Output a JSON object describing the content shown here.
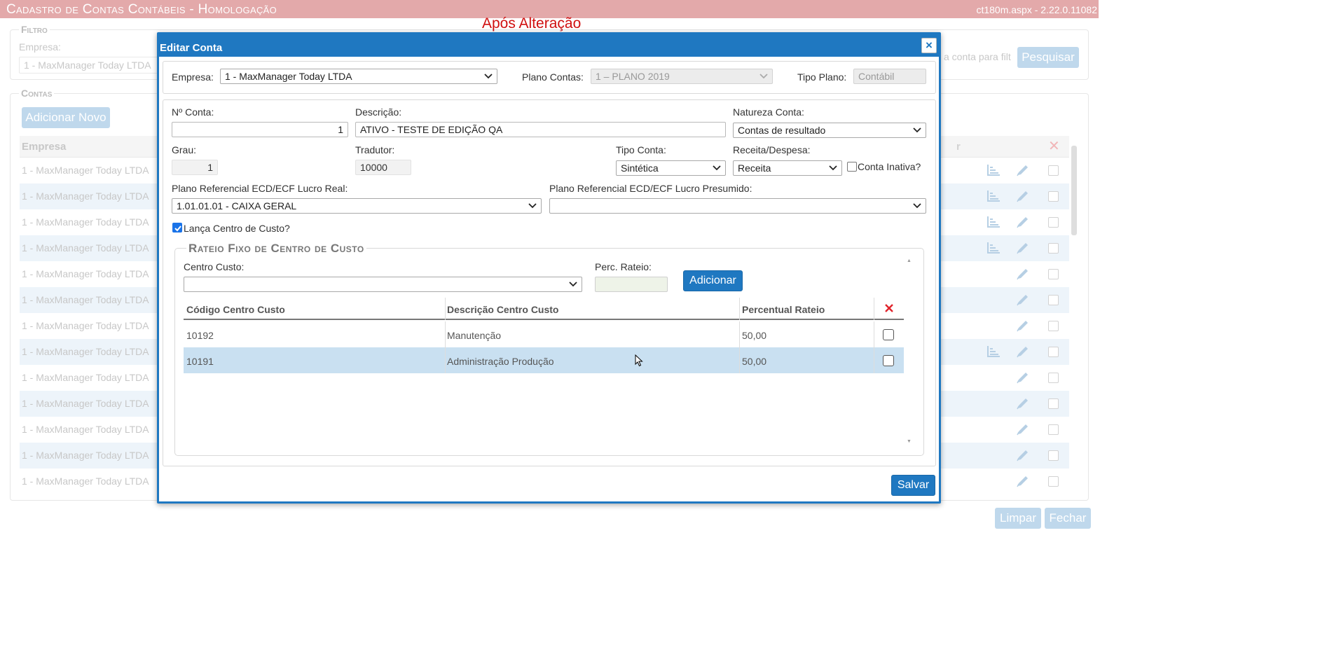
{
  "page": {
    "title": "Cadastro de Contas Contábeis  - Homologação",
    "version": "ct180m.aspx - 2.22.0.11082",
    "annotation": "Após Alteração"
  },
  "filter": {
    "legend": "Filtro",
    "empresa_label": "Empresa:",
    "empresa_value": "1 - MaxManager Today LTDA",
    "search_placeholder": "a conta para filt",
    "search_button": "Pesquisar"
  },
  "contas": {
    "legend": "Contas",
    "add_button": "Adicionar Novo",
    "col_empresa": "Empresa",
    "col_partial": "r",
    "rows": [
      {
        "empresa": "1 - MaxManager Today LTDA",
        "chart": true
      },
      {
        "empresa": "1 - MaxManager Today LTDA",
        "chart": true
      },
      {
        "empresa": "1 - MaxManager Today LTDA",
        "chart": true
      },
      {
        "empresa": "1 - MaxManager Today LTDA",
        "chart": true
      },
      {
        "empresa": "1 - MaxManager Today LTDA",
        "chart": false
      },
      {
        "empresa": "1 - MaxManager Today LTDA",
        "chart": false
      },
      {
        "empresa": "1 - MaxManager Today LTDA",
        "chart": false
      },
      {
        "empresa": "1 - MaxManager Today LTDA",
        "chart": true
      },
      {
        "empresa": "1 - MaxManager Today LTDA",
        "chart": false
      },
      {
        "empresa": "1 - MaxManager Today LTDA",
        "chart": false
      },
      {
        "empresa": "1 - MaxManager Today LTDA",
        "chart": false
      },
      {
        "empresa": "1 - MaxManager Today LTDA",
        "chart": false
      },
      {
        "empresa": "1 - MaxManager Today LTDA",
        "chart": false
      }
    ]
  },
  "footer": {
    "limpar": "Limpar",
    "fechar": "Fechar"
  },
  "modal": {
    "title": "Editar Conta",
    "close": "×",
    "empresa_label": "Empresa:",
    "empresa_value": "1 - MaxManager Today LTDA",
    "plano_contas_label": "Plano Contas:",
    "plano_contas_value": "1 – PLANO 2019",
    "tipo_plano_label": "Tipo Plano:",
    "tipo_plano_value": "Contábil",
    "num_conta_label": "Nº Conta:",
    "num_conta_value": "1",
    "descricao_label": "Descrição:",
    "descricao_value": "ATIVO - TESTE DE EDIÇÃO QA",
    "natureza_label": "Natureza Conta:",
    "natureza_value": "Contas de resultado",
    "grau_label": "Grau:",
    "grau_value": "1",
    "tradutor_label": "Tradutor:",
    "tradutor_value": "10000",
    "tipo_conta_label": "Tipo Conta:",
    "tipo_conta_value": "Sintética",
    "receita_label": "Receita/Despesa:",
    "receita_value": "Receita",
    "conta_inativa_label": "Conta Inativa?",
    "conta_inativa_checked": false,
    "plano_real_label": "Plano Referencial ECD/ECF Lucro Real:",
    "plano_real_value": "1.01.01.01 - CAIXA GERAL",
    "plano_presumido_label": "Plano Referencial ECD/ECF Lucro Presumido:",
    "plano_presumido_value": "",
    "lanca_cc_label": "Lança Centro de Custo?",
    "lanca_cc_checked": true,
    "rateio": {
      "legend": "Rateio Fixo de Centro de Custo",
      "centro_custo_label": "Centro Custo:",
      "centro_custo_value": "",
      "perc_label": "Perc. Rateio:",
      "perc_value": "",
      "add_button": "Adicionar",
      "columns": [
        "Código Centro Custo",
        "Descrição Centro Custo",
        "Percentual Rateio"
      ],
      "rows": [
        {
          "codigo": "10192",
          "descricao": "Manutenção",
          "percentual": "50,00",
          "selected": false
        },
        {
          "codigo": "10191",
          "descricao": "Administração Produção",
          "percentual": "50,00",
          "selected": true
        }
      ]
    },
    "save_button": "Salvar"
  },
  "colors": {
    "topbar": "#e3a9aa",
    "modal_header": "#1f78c1",
    "annotation": "#d01010",
    "delete_x": "#e0242c",
    "row_selected": "#c9e0f1"
  }
}
